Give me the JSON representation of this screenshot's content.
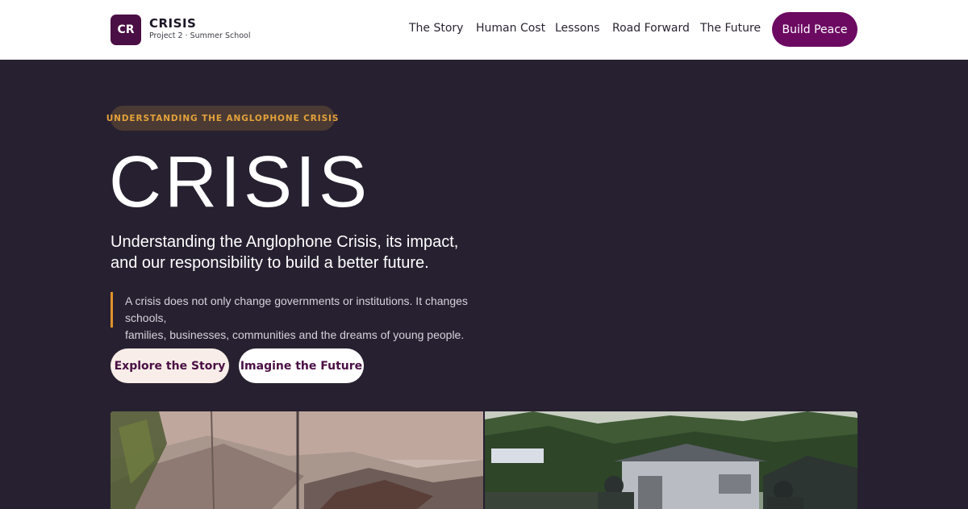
{
  "header": {
    "logo_text": "CR",
    "brand_title": "CRISIS",
    "brand_subtitle": "Project 2 · Summer School",
    "nav": [
      "The Story",
      "Human Cost",
      "Lessons",
      "Road Forward",
      "The Future"
    ],
    "cta_label": "Build Peace"
  },
  "hero": {
    "eyebrow": "UNDERSTANDING THE ANGLOPHONE CRISIS",
    "title": "CRISIS",
    "subtitle_line1": "Understanding the Anglophone Crisis, its impact,",
    "subtitle_line2": "and our responsibility to build a better future.",
    "quote_line1": "A crisis does not only change governments or institutions. It changes schools,",
    "quote_line2": "families, businesses, communities and the dreams of young people.",
    "buttons": [
      "Explore the Story",
      "Imagine the Future"
    ]
  },
  "colors": {
    "background": "#272030",
    "brand": "#6c0a62",
    "accent": "#e0932a",
    "eyebrow_text": "#e3a13a"
  },
  "images": [
    "town-rooftops-photo",
    "soldiers-village-photo"
  ]
}
